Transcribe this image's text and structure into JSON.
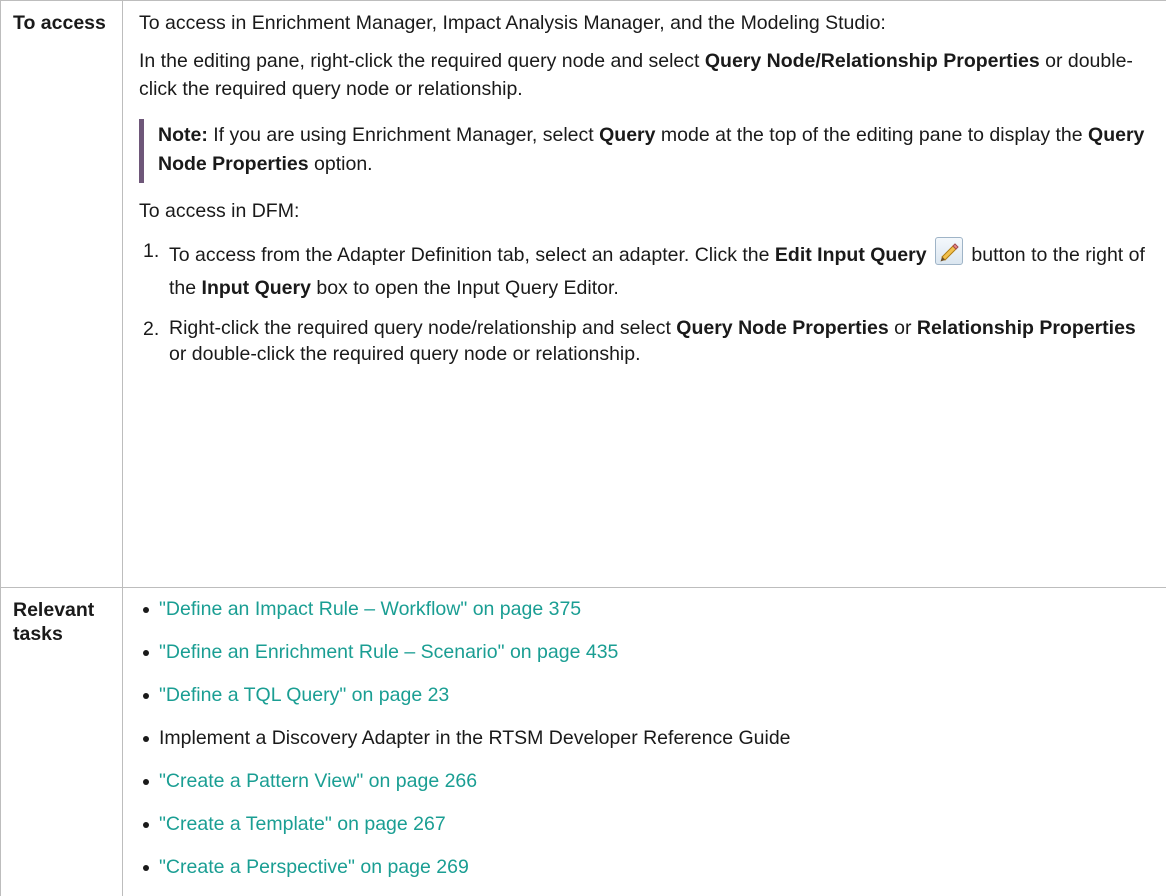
{
  "access": {
    "label": "To access",
    "intro": "To access in Enrichment Manager, Impact Analysis Manager, and the Modeling Studio:",
    "editing_pane": {
      "t1": "In the editing pane, right-click the required query node and select ",
      "b1": "Query Node/Relationship Properties",
      "t2": " or double-click the required query node or relationship."
    },
    "note": {
      "label": "Note:",
      "t1": " If you are using Enrichment Manager, select ",
      "b1": "Query",
      "t2": " mode at the top of the editing pane to display the ",
      "b2": "Query Node Properties",
      "t3": " option."
    },
    "dfm_intro": "To access in DFM:",
    "steps": [
      {
        "num": "1.",
        "t1": "To access from the Adapter Definition tab, select an adapter. Click the ",
        "b1": "Edit Input Query",
        "t2": " button to the right of the ",
        "b2": "Input Query",
        "t3": " box to open the Input Query Editor."
      },
      {
        "num": "2.",
        "t1": "Right-click the required query node/relationship and select ",
        "b1": "Query Node Properties",
        "t2": " or ",
        "b2": "Relationship Properties",
        "t3": " or double-click the required query node or relationship."
      }
    ]
  },
  "tasks": {
    "label": "Relevant tasks",
    "items": [
      {
        "text": "\"Define an Impact Rule – Workflow\" on page 375",
        "is_link": true
      },
      {
        "text": "\"Define an Enrichment Rule – Scenario\" on page 435",
        "is_link": true
      },
      {
        "text": "\"Define a TQL Query\" on page 23",
        "is_link": true
      },
      {
        "text": "Implement a Discovery Adapter in the RTSM Developer Reference Guide",
        "is_link": false
      },
      {
        "text": "\"Create a Pattern View\" on page 266",
        "is_link": true
      },
      {
        "text": "\"Create a Template\" on page 267",
        "is_link": true
      },
      {
        "text": "\"Create a Perspective\" on page 269",
        "is_link": true
      }
    ]
  },
  "colors": {
    "link": "#1a9e93",
    "note_bar": "#6e5779",
    "border": "#bdbdbd"
  },
  "icons": {
    "edit": "pencil-icon"
  }
}
